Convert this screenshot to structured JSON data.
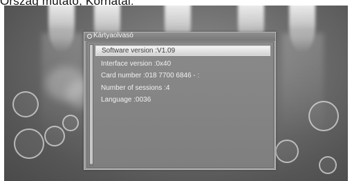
{
  "caption": "Ország mutató, Kornatal:",
  "dialog": {
    "title": "Kártyaolvasó",
    "selected_index": 0,
    "rows": [
      "Software version :V1.09",
      "Interface version :0x40",
      "Card number :018 7700 6846 - :",
      "Number of sessions :4",
      "Language :0036"
    ]
  },
  "colors": {
    "selection_highlight": "#e6e6e6",
    "dialog_background": "#8a8a8a",
    "text": "#f2f2f2"
  }
}
